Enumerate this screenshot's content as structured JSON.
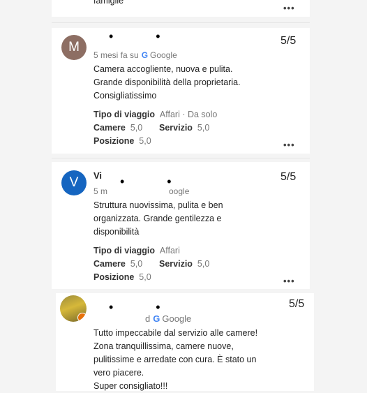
{
  "top_fragment": {
    "text": "famiglie"
  },
  "reviews": [
    {
      "avatar_letter": "M",
      "avatar_color": "#8d6e63",
      "name_redacted": "• •",
      "meta": "5 mesi fa su",
      "source": "Google",
      "score": "5/5",
      "text": [
        "Camera accogliente, nuova e pulita.",
        "Grande disponibilità della proprietaria.",
        "Consigliatissimo"
      ],
      "trip_label": "Tipo di viaggio",
      "trip_value": "Affari · Da solo",
      "rooms_label": "Camere",
      "rooms_value": "5,0",
      "service_label": "Servizio",
      "service_value": "5,0",
      "position_label": "Posizione",
      "position_value": "5,0"
    },
    {
      "avatar_letter": "V",
      "avatar_color": "#1565c0",
      "name_fragment": "Vi",
      "name_redacted": "• •",
      "meta_start": "5 m",
      "meta_end": "oogle",
      "score": "5/5",
      "text": [
        "Struttura nuovissima, pulita e ben",
        "organizzata. Grande gentilezza e",
        "disponibilità"
      ],
      "trip_label": "Tipo di viaggio",
      "trip_value": "Affari",
      "rooms_label": "Camere",
      "rooms_value": "5,0",
      "service_label": "Servizio",
      "service_value": "5,0",
      "position_label": "Posizione",
      "position_value": "5,0"
    },
    {
      "name_redacted": "• •",
      "meta_start": "d",
      "source": "Google",
      "score": "5/5",
      "text": [
        "Tutto impeccabile dal servizio alle camere!",
        "Zona tranquillissima, camere nuove,",
        "pulitissime e arredate con cura. È stato un",
        "vero piacere.",
        "Super consigliato!!!"
      ]
    }
  ],
  "more_glyph": "•••"
}
